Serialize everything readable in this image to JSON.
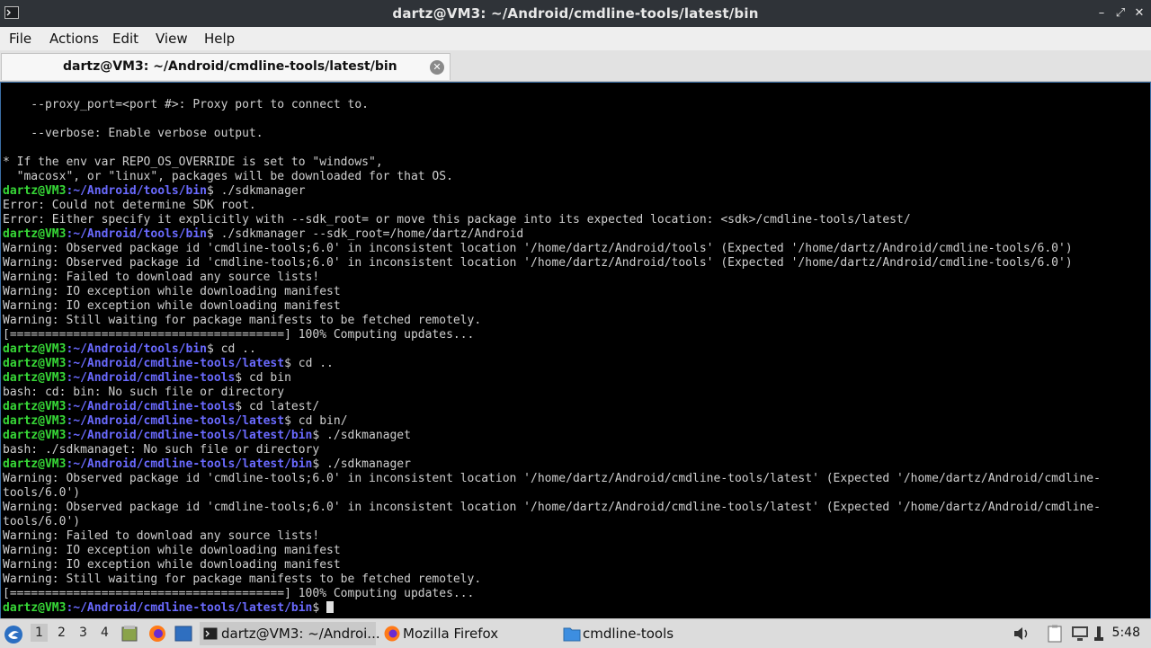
{
  "window": {
    "title": "dartz@VM3: ~/Android/cmdline-tools/latest/bin",
    "minimize": "–",
    "maximize": "⤢",
    "close": "✕"
  },
  "menu": [
    "File",
    "Actions",
    "Edit",
    "View",
    "Help"
  ],
  "tab": {
    "title": "dartz@VM3: ~/Android/cmdline-tools/latest/bin",
    "close": "✕"
  },
  "terminal": {
    "lines": [
      {
        "t": "    --proxy_port=<port #>: Proxy port to connect to."
      },
      {
        "t": ""
      },
      {
        "t": "    --verbose: Enable verbose output."
      },
      {
        "t": ""
      },
      {
        "t": "* If the env var REPO_OS_OVERRIDE is set to \"windows\","
      },
      {
        "t": "  \"macosx\", or \"linux\", packages will be downloaded for that OS."
      },
      {
        "u": "dartz@VM3",
        "p": ":~/Android/tools/bin",
        "c": "$ ./sdkmanager"
      },
      {
        "t": "Error: Could not determine SDK root."
      },
      {
        "t": "Error: Either specify it explicitly with --sdk_root= or move this package into its expected location: <sdk>/cmdline-tools/latest/"
      },
      {
        "u": "dartz@VM3",
        "p": ":~/Android/tools/bin",
        "c": "$ ./sdkmanager --sdk_root=/home/dartz/Android"
      },
      {
        "t": "Warning: Observed package id 'cmdline-tools;6.0' in inconsistent location '/home/dartz/Android/tools' (Expected '/home/dartz/Android/cmdline-tools/6.0')"
      },
      {
        "t": "Warning: Observed package id 'cmdline-tools;6.0' in inconsistent location '/home/dartz/Android/tools' (Expected '/home/dartz/Android/cmdline-tools/6.0')"
      },
      {
        "t": "Warning: Failed to download any source lists!"
      },
      {
        "t": "Warning: IO exception while downloading manifest"
      },
      {
        "t": "Warning: IO exception while downloading manifest"
      },
      {
        "t": "Warning: Still waiting for package manifests to be fetched remotely."
      },
      {
        "t": "[=======================================] 100% Computing updates..."
      },
      {
        "u": "dartz@VM3",
        "p": ":~/Android/tools/bin",
        "c": "$ cd .."
      },
      {
        "u": "dartz@VM3",
        "p": ":~/Android/cmdline-tools/latest",
        "c": "$ cd .."
      },
      {
        "u": "dartz@VM3",
        "p": ":~/Android/cmdline-tools",
        "c": "$ cd bin"
      },
      {
        "t": "bash: cd: bin: No such file or directory"
      },
      {
        "u": "dartz@VM3",
        "p": ":~/Android/cmdline-tools",
        "c": "$ cd latest/"
      },
      {
        "u": "dartz@VM3",
        "p": ":~/Android/cmdline-tools/latest",
        "c": "$ cd bin/"
      },
      {
        "u": "dartz@VM3",
        "p": ":~/Android/cmdline-tools/latest/bin",
        "c": "$ ./sdkmanaget"
      },
      {
        "t": "bash: ./sdkmanaget: No such file or directory"
      },
      {
        "u": "dartz@VM3",
        "p": ":~/Android/cmdline-tools/latest/bin",
        "c": "$ ./sdkmanager"
      },
      {
        "t": "Warning: Observed package id 'cmdline-tools;6.0' in inconsistent location '/home/dartz/Android/cmdline-tools/latest' (Expected '/home/dartz/Android/cmdline-"
      },
      {
        "t": "tools/6.0')"
      },
      {
        "t": "Warning: Observed package id 'cmdline-tools;6.0' in inconsistent location '/home/dartz/Android/cmdline-tools/latest' (Expected '/home/dartz/Android/cmdline-"
      },
      {
        "t": "tools/6.0')"
      },
      {
        "t": "Warning: Failed to download any source lists!"
      },
      {
        "t": "Warning: IO exception while downloading manifest"
      },
      {
        "t": "Warning: IO exception while downloading manifest"
      },
      {
        "t": "Warning: Still waiting for package manifests to be fetched remotely."
      },
      {
        "t": "[=======================================] 100% Computing updates..."
      },
      {
        "u": "dartz@VM3",
        "p": ":~/Android/cmdline-tools/latest/bin",
        "c": "$ ",
        "cursor": true
      }
    ]
  },
  "taskbar": {
    "workspaces": [
      "1",
      "2",
      "3",
      "4"
    ],
    "tasks": [
      {
        "label": "dartz@VM3: ~/Androi...",
        "icon": "terminal-icon"
      },
      {
        "label": "Mozilla Firefox",
        "icon": "firefox-icon"
      },
      {
        "label": "cmdline-tools",
        "icon": "folder-icon"
      }
    ],
    "clock": "5:48"
  },
  "colors": {
    "prompt_user": "#37d837",
    "prompt_path": "#6a6aff",
    "terminal_bg": "#000000",
    "terminal_text": "#cfcfcf"
  }
}
